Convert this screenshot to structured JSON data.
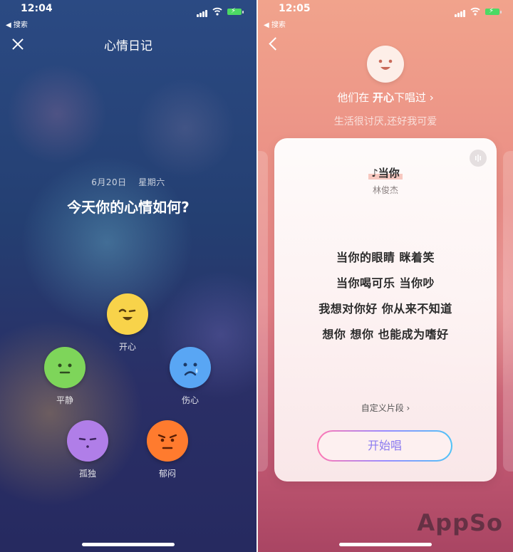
{
  "left_screen": {
    "status": {
      "time": "12:04",
      "back_label": "◀ 搜索"
    },
    "nav_title": "心情日记",
    "date": {
      "day": "6月20日",
      "weekday": "星期六"
    },
    "question": "今天你的心情如何?",
    "moods": [
      {
        "key": "happy",
        "label": "开心",
        "color": "#f8d34a"
      },
      {
        "key": "calm",
        "label": "平静",
        "color": "#7ed55a"
      },
      {
        "key": "sad",
        "label": "伤心",
        "color": "#59a6f4"
      },
      {
        "key": "lonely",
        "label": "孤独",
        "color": "#b07ee8"
      },
      {
        "key": "gloomy",
        "label": "郁闷",
        "color": "#ff7b2e"
      }
    ]
  },
  "right_screen": {
    "status": {
      "time": "12:05",
      "back_label": "◀ 搜索"
    },
    "sang_prefix": "他们在",
    "sang_mood": "开心",
    "sang_suffix": "下唱过 ›",
    "tagline": "生活很讨厌,还好我可爱",
    "song": {
      "title": "当你",
      "artist": "林俊杰"
    },
    "lyrics": [
      "当你的眼睛 眯着笑",
      "当你喝可乐 当你吵",
      "我想对你好 你从来不知道",
      "想你 想你 也能成为嗜好"
    ],
    "custom_segment": "自定义片段 ›",
    "start_button": "开始唱"
  },
  "watermark": "AppSo"
}
